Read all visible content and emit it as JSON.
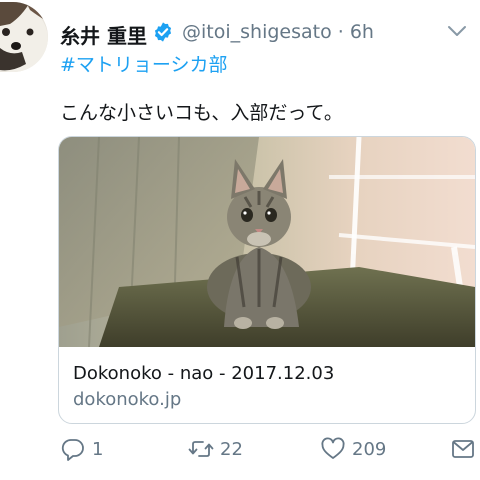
{
  "tweet": {
    "author_name": "糸井 重里",
    "handle": "@itoi_shigesato · 6h",
    "hashtag": "#マトリョーシカ部",
    "text": "こんな小さいコも、入部だって。"
  },
  "card": {
    "title": "Dokonoko - nao - 2017.12.03",
    "domain": "dokonoko.jp"
  },
  "actions": {
    "reply_count": "1",
    "retweet_count": "22",
    "like_count": "209"
  },
  "colors": {
    "link": "#1da1f2",
    "secondary_text": "#657786",
    "verified_badge": "#1da1f2"
  },
  "icons": [
    "avatar-dog",
    "verified-badge-icon",
    "chevron-down-icon",
    "reply-icon",
    "retweet-icon",
    "like-icon",
    "direct-message-icon"
  ]
}
